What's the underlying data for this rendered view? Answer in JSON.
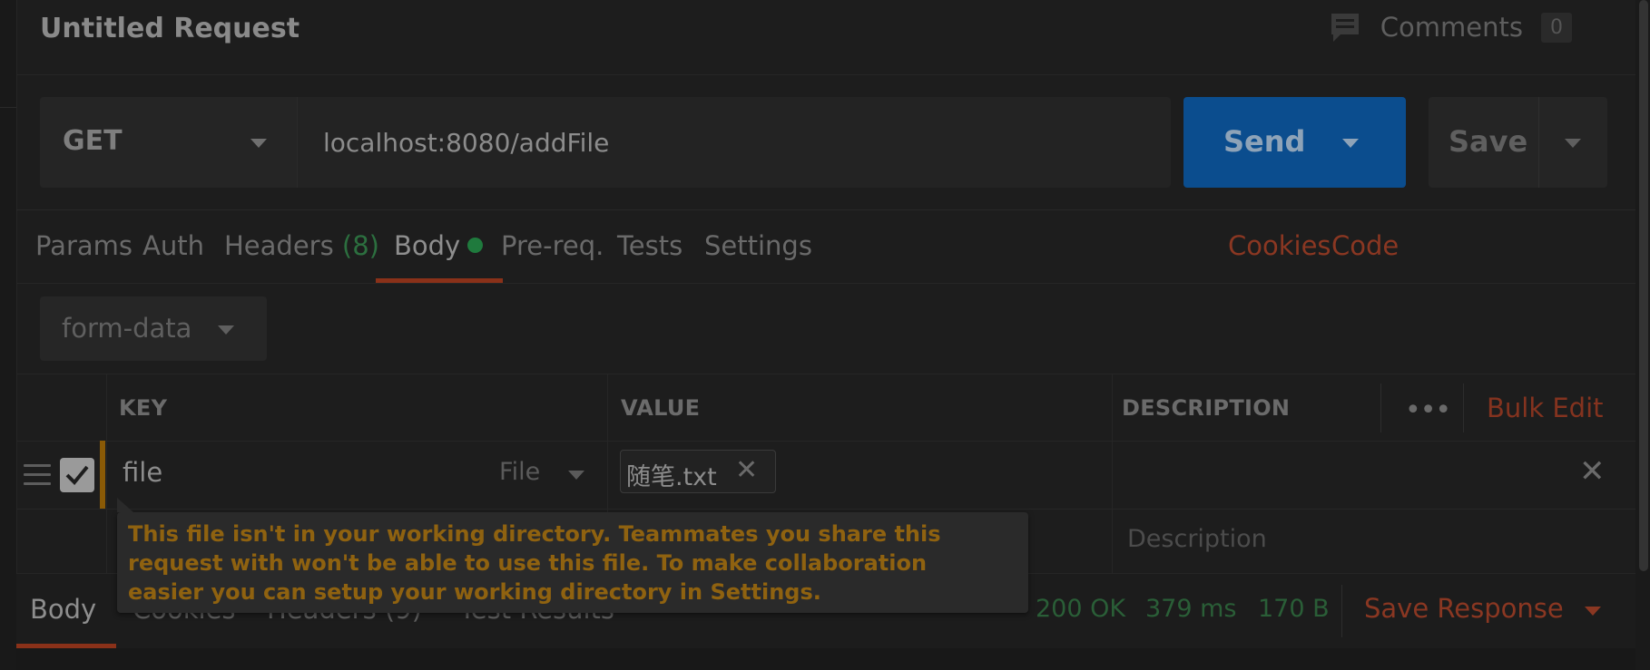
{
  "request": {
    "title": "Untitled Request",
    "comments_label": "Comments",
    "comments_count": "0"
  },
  "url_bar": {
    "method": "GET",
    "url": "localhost:8080/addFile",
    "send_label": "Send",
    "save_label": "Save"
  },
  "tabs": {
    "params": "Params",
    "auth": "Auth",
    "headers": "Headers",
    "headers_count": "(8)",
    "body": "Body",
    "prereq": "Pre-req.",
    "tests": "Tests",
    "settings": "Settings",
    "cookies": "Cookies",
    "code": "Code"
  },
  "body": {
    "mode": "form-data"
  },
  "table": {
    "headers": {
      "key": "KEY",
      "value": "VALUE",
      "description": "DESCRIPTION"
    },
    "bulk_edit": "Bulk Edit",
    "rows": [
      {
        "key": "file",
        "type": "File",
        "value": "随笔.txt",
        "checked": true
      }
    ],
    "description_placeholder": "Description"
  },
  "tooltip": {
    "text": "This file isn't in your working directory. Teammates you share this request with won't be able to use this file. To make collaboration easier you can setup your working directory in Settings."
  },
  "response": {
    "tabs": {
      "body": "Body",
      "cookies": "Cookies",
      "headers": "Headers",
      "headers_count": "(9)",
      "test_results": "Test Results"
    },
    "status": "200 OK",
    "time": "379 ms",
    "size": "170 B",
    "save_response": "Save Response"
  },
  "colors": {
    "send_button": "#0b4d8e",
    "active_tab_underline": "#8a3119",
    "status_green": "#2a5e37",
    "tooltip_text": "#8f6210",
    "link_orange": "#8a3722"
  },
  "icons": {
    "comments": "speech-bubble-icon",
    "drag_handle": "hamburger-icon",
    "checkbox": "checkmark-icon",
    "remove": "close-icon",
    "more": "ellipsis-icon",
    "dropdown": "caret-down-icon"
  }
}
